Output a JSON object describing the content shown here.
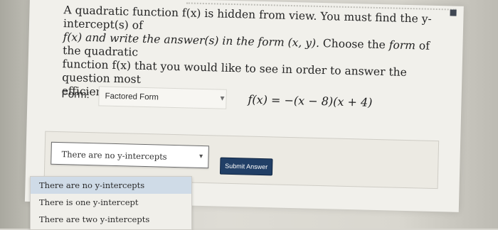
{
  "question": {
    "line1": "A quadratic function f(x) is hidden from view. You must find the y-intercept(s) of",
    "line2_a": "f(x) and write the answer(s) in the form (x, y).",
    "line2_b": " Choose the ",
    "line2_c": "form",
    "line2_d": " of the quadratic",
    "line3": "function f(x) that you would like to see in order to answer the question most",
    "line4": "efficiently."
  },
  "form": {
    "label": "Form:",
    "selected": "Factored Form",
    "expression": "f(x) = −(x − 8)(x + 4)"
  },
  "answer": {
    "selected": "There are no y-intercepts",
    "submit_label": "Submit Answer",
    "options": [
      "There are no y-intercepts",
      "There is one y-intercept",
      "There are two y-intercepts"
    ]
  },
  "colors": {
    "submit_bg": "#213f66",
    "highlight": "#cfdbe7"
  },
  "icons": {
    "select_chevron": "chevron-down-icon"
  }
}
